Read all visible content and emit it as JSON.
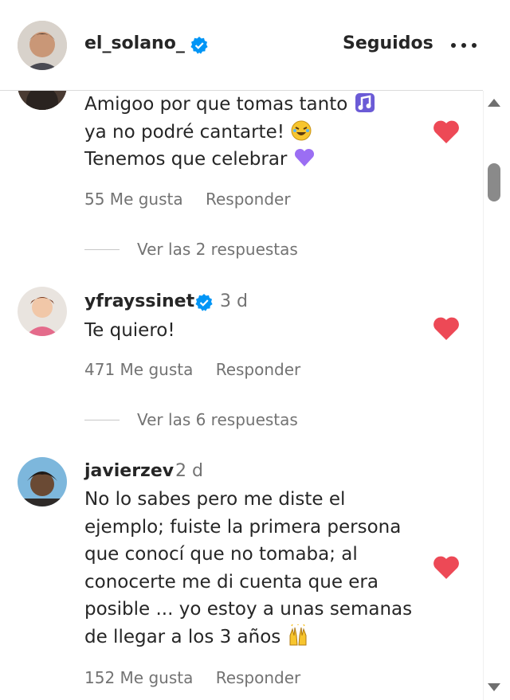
{
  "header": {
    "username": "el_solano_",
    "verified_icon": "verified-badge-icon",
    "follow_label": "Seguidos",
    "more_icon": "more-options-icon"
  },
  "colors": {
    "heart": "#ed4956",
    "verified": "#0095f6",
    "muted": "#737373",
    "text": "#262626"
  },
  "comments": [
    {
      "username": "",
      "time": "",
      "lines": [
        "Amigoo por que tomas tanto",
        "ya no podré cantarte!",
        "Tenemos que celebrar"
      ],
      "emojis": [
        "musical-notes-icon",
        "rolling-laughing-face-icon",
        "purple-heart-icon"
      ],
      "likes": "55 Me gusta",
      "reply_label": "Responder",
      "view_replies": "Ver las 2 respuestas"
    },
    {
      "username": "yfrayssinet",
      "time": "3 d",
      "lines": [
        "Te quiero!"
      ],
      "likes": "471 Me gusta",
      "reply_label": "Responder",
      "view_replies": "Ver las 6 respuestas"
    },
    {
      "username": "javierzev",
      "time": "2 d",
      "lines": [
        "No lo sabes pero me diste el",
        "ejemplo; fuiste la primera persona",
        "que conocí que no tomaba; al",
        "conocerte me di cuenta que era",
        "posible ... yo estoy a unas semanas",
        "de llegar a los 3 años"
      ],
      "emojis": [
        "raising-hands-icon"
      ],
      "likes": "152 Me gusta",
      "reply_label": "Responder"
    }
  ]
}
